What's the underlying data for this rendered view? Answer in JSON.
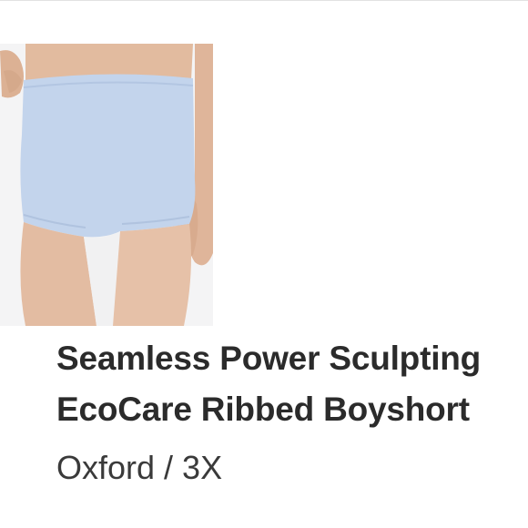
{
  "product": {
    "image_alt": "Light blue seamless boyshort",
    "title_line1": "Seamless Power Sculpting",
    "title_line2": "EcoCare Ribbed Boyshort",
    "variant": "Oxford / 3X"
  },
  "colors": {
    "background": "#ffffff",
    "text_primary": "#2b2b2b",
    "text_secondary": "#3a3a3a",
    "garment": "#c3d4ec",
    "skin": "#e3bca2"
  }
}
